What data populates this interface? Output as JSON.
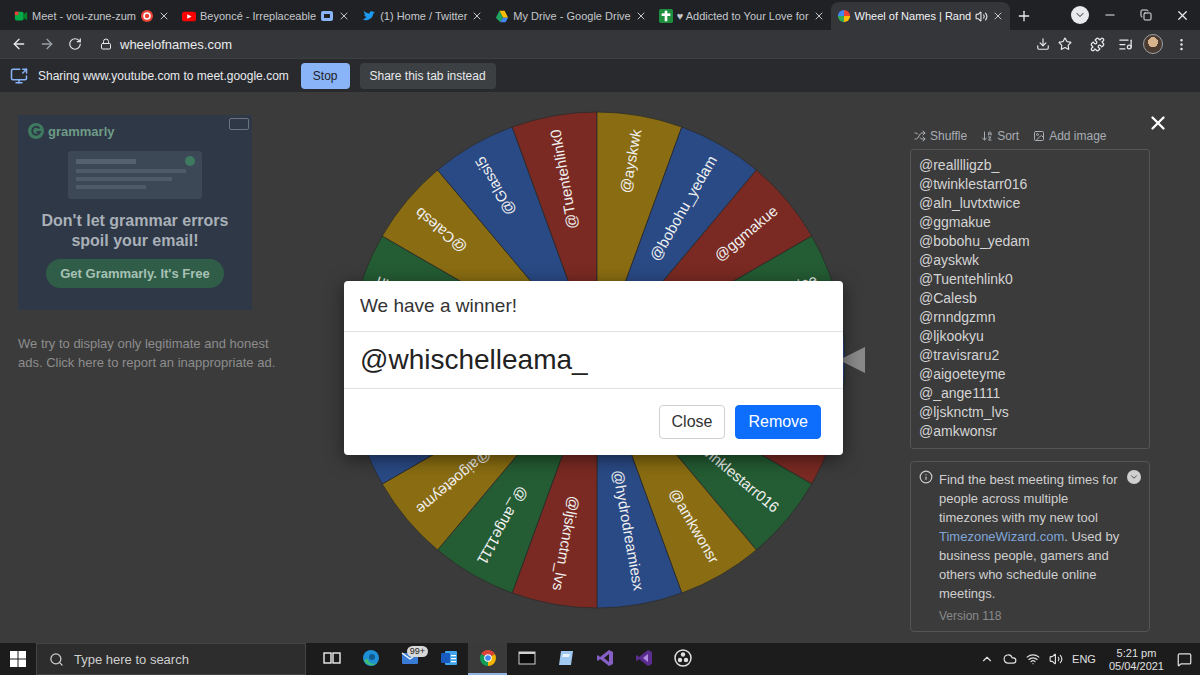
{
  "browser": {
    "tabs": [
      {
        "label": "Meet - vou-zune-zum",
        "selected": false,
        "kind": "meet",
        "indicator": "recording"
      },
      {
        "label": "Beyoncé - Irreplaceable",
        "selected": false,
        "kind": "youtube",
        "indicator": "casting"
      },
      {
        "label": "(1) Home / Twitter",
        "selected": false,
        "kind": "twitter",
        "indicator": "none"
      },
      {
        "label": "My Drive - Google Drive",
        "selected": false,
        "kind": "drive",
        "indicator": "none"
      },
      {
        "label": "♥ Addicted to Your Love for",
        "selected": false,
        "kind": "cross",
        "indicator": "none"
      },
      {
        "label": "Wheel of Names | Rand",
        "selected": true,
        "kind": "wheel",
        "indicator": "audio"
      }
    ],
    "address": "wheelofnames.com"
  },
  "sharing_bar": {
    "message": "Sharing www.youtube.com to meet.google.com",
    "stop": "Stop",
    "share_tab": "Share this tab instead"
  },
  "ad": {
    "brand": "grammarly",
    "headline": "Don't let grammar errors spoil your email!",
    "cta": "Get Grammarly. It's Free",
    "note": "We try to display only legitimate and honest ads. Click here to report an inappropriate ad."
  },
  "wheel": {
    "slices": [
      {
        "label": "@whischelleama_",
        "color": "#2a4a85"
      },
      {
        "label": "@realllligzb_",
        "color": "#7a2a22"
      },
      {
        "label": "@twinklestarr016",
        "color": "#245c33"
      },
      {
        "label": "@amkwonsr",
        "color": "#8a6d12"
      },
      {
        "label": "@hydrodreamiesx",
        "color": "#2a4a85"
      },
      {
        "label": "@ljsknctm_lvs",
        "color": "#7a2a22"
      },
      {
        "label": "@_ange1111",
        "color": "#245c33"
      },
      {
        "label": "@aigoeteyme",
        "color": "#8a6d12"
      },
      {
        "label": "@travisraru2",
        "color": "#2a4a85"
      },
      {
        "label": "@ljkookyu",
        "color": "#7a2a22"
      },
      {
        "label": "@rnndgzmn",
        "color": "#245c33"
      },
      {
        "label": "@Calesb",
        "color": "#8a6d12"
      },
      {
        "label": "@Glassi5",
        "color": "#2a4a85"
      },
      {
        "label": "@Tuentehlink0",
        "color": "#7a2a22"
      },
      {
        "label": "@ayskwk",
        "color": "#8a6d12"
      },
      {
        "label": "@bobohu_yedam",
        "color": "#2a4a85"
      },
      {
        "label": "@ggmakue",
        "color": "#7a2a22"
      },
      {
        "label": "@aln_luvtxtwice",
        "color": "#245c33"
      }
    ]
  },
  "entries_panel": {
    "tools": [
      {
        "label": "Shuffle",
        "kind": "shuffle"
      },
      {
        "label": "Sort",
        "kind": "sort"
      },
      {
        "label": "Add image",
        "kind": "image"
      }
    ],
    "entries": [
      "@realllligzb_",
      "@twinklestarr016",
      "@aln_luvtxtwice",
      "@ggmakue",
      "@bobohu_yedam",
      "@ayskwk",
      "@Tuentehlink0",
      "@Calesb",
      "@rnndgzmn",
      "@ljkookyu",
      "@travisraru2",
      "@aigoeteyme",
      "@_ange1111",
      "@ljsknctm_lvs",
      "@amkwonsr"
    ],
    "notice": {
      "before": "Find the best meeting times for people across multiple timezones with my new tool ",
      "link": "TimezoneWizard.com",
      "after": ". Used by business people, gamers and others who schedule online meetings."
    },
    "version": "Version 118"
  },
  "dialog": {
    "title": "We have a winner!",
    "winner": "@whischelleama_",
    "buttons": [
      {
        "label": "Close",
        "primary": false
      },
      {
        "label": "Remove",
        "primary": true
      }
    ]
  },
  "taskbar": {
    "search_placeholder": "Type here to search",
    "apps": [
      {
        "kind": "taskview",
        "active": false,
        "badge": ""
      },
      {
        "kind": "edge",
        "active": false,
        "badge": ""
      },
      {
        "kind": "mail",
        "active": false,
        "badge": "99+"
      },
      {
        "kind": "word",
        "active": false,
        "badge": ""
      },
      {
        "kind": "chrome",
        "active": true,
        "badge": ""
      },
      {
        "kind": "terminal",
        "active": false,
        "badge": ""
      },
      {
        "kind": "notes",
        "active": false,
        "badge": ""
      },
      {
        "kind": "vs",
        "active": false,
        "badge": ""
      },
      {
        "kind": "vs2",
        "active": false,
        "badge": ""
      },
      {
        "kind": "obs",
        "active": false,
        "badge": ""
      }
    ],
    "tray": {
      "language": "ENG",
      "time": "5:21 pm",
      "date": "05/04/2021"
    }
  }
}
